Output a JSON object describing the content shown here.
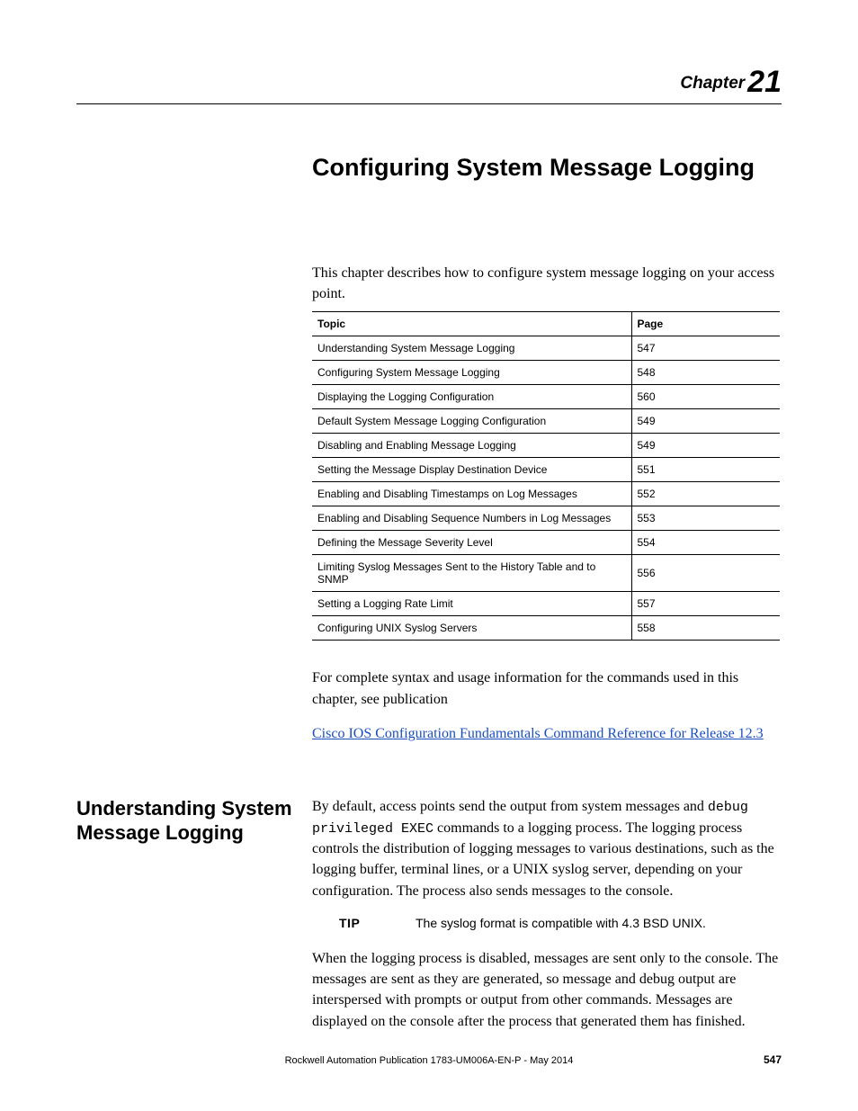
{
  "chapter": {
    "label": "Chapter",
    "number": "21"
  },
  "title": "Configuring System Message Logging",
  "intro": "This chapter describes how to configure system message logging on your access point.",
  "toc": {
    "headers": {
      "topic": "Topic",
      "page": "Page"
    },
    "rows": [
      {
        "topic": "Understanding System Message Logging",
        "page": "547"
      },
      {
        "topic": "Configuring System Message Logging",
        "page": "548"
      },
      {
        "topic": "Displaying the Logging Configuration",
        "page": "560"
      },
      {
        "topic": "Default System Message Logging Configuration",
        "page": "549"
      },
      {
        "topic": "Disabling and Enabling Message Logging",
        "page": "549"
      },
      {
        "topic": "Setting the Message Display Destination Device",
        "page": "551"
      },
      {
        "topic": "Enabling and Disabling Timestamps on Log Messages",
        "page": "552"
      },
      {
        "topic": "Enabling and Disabling Sequence Numbers in Log Messages",
        "page": "553"
      },
      {
        "topic": "Defining the Message Severity Level",
        "page": "554"
      },
      {
        "topic": "Limiting Syslog Messages Sent to the History Table and to SNMP",
        "page": "556"
      },
      {
        "topic": "Setting a Logging Rate Limit",
        "page": "557"
      },
      {
        "topic": "Configuring UNIX Syslog Servers",
        "page": "558"
      }
    ]
  },
  "after_table": "For complete syntax and usage information for the commands used in this chapter, see publication",
  "link_text": "Cisco IOS Configuration Fundamentals Command Reference for Release 12.3",
  "section": {
    "heading": "Understanding System Message Logging",
    "para1_a": "By default, access points send the output from system messages and ",
    "code1": "debug privileged EXEC",
    "para1_b": " commands to a logging process. The logging process controls the distribution of logging messages to various destinations, such as the logging buffer, terminal lines, or a UNIX syslog server, depending on your configuration. The process also sends messages to the console.",
    "tip_label": "TIP",
    "tip_text": "The syslog format is compatible with 4.3 BSD UNIX.",
    "para2": "When the logging process is disabled, messages are sent only to the console. The messages are sent as they are generated, so message and debug output are interspersed with prompts or output from other commands. Messages are displayed on the console after the process that generated them has finished."
  },
  "footer": "Rockwell Automation Publication 1783-UM006A-EN-P - May 2014",
  "page_number": "547"
}
